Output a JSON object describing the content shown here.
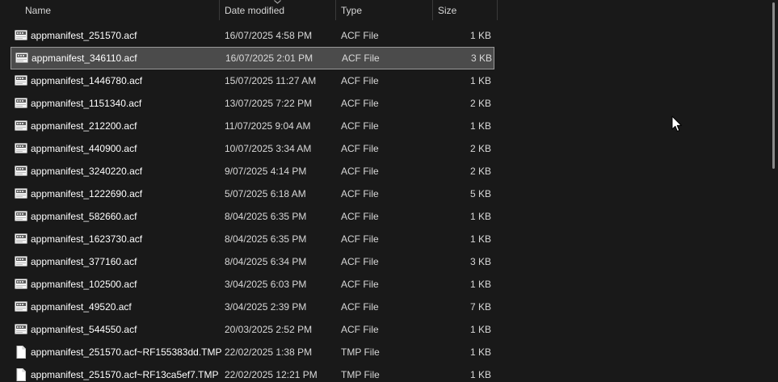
{
  "columns": {
    "name": "Name",
    "date": "Date modified",
    "type": "Type",
    "size": "Size"
  },
  "sort": {
    "column": "date",
    "icon": "sort-descending-icon"
  },
  "files": [
    {
      "name": "appmanifest_251570.acf",
      "date": "16/07/2025 4:58 PM",
      "type": "ACF File",
      "size": "1 KB",
      "icon": "acf-file-icon",
      "selected": false
    },
    {
      "name": "appmanifest_346110.acf",
      "date": "16/07/2025 2:01 PM",
      "type": "ACF File",
      "size": "3 KB",
      "icon": "acf-file-icon",
      "selected": true
    },
    {
      "name": "appmanifest_1446780.acf",
      "date": "15/07/2025 11:27 AM",
      "type": "ACF File",
      "size": "1 KB",
      "icon": "acf-file-icon",
      "selected": false
    },
    {
      "name": "appmanifest_1151340.acf",
      "date": "13/07/2025 7:22 PM",
      "type": "ACF File",
      "size": "2 KB",
      "icon": "acf-file-icon",
      "selected": false
    },
    {
      "name": "appmanifest_212200.acf",
      "date": "11/07/2025 9:04 AM",
      "type": "ACF File",
      "size": "1 KB",
      "icon": "acf-file-icon",
      "selected": false
    },
    {
      "name": "appmanifest_440900.acf",
      "date": "10/07/2025 3:34 AM",
      "type": "ACF File",
      "size": "2 KB",
      "icon": "acf-file-icon",
      "selected": false
    },
    {
      "name": "appmanifest_3240220.acf",
      "date": "9/07/2025 4:14 PM",
      "type": "ACF File",
      "size": "2 KB",
      "icon": "acf-file-icon",
      "selected": false
    },
    {
      "name": "appmanifest_1222690.acf",
      "date": "5/07/2025 6:18 AM",
      "type": "ACF File",
      "size": "5 KB",
      "icon": "acf-file-icon",
      "selected": false
    },
    {
      "name": "appmanifest_582660.acf",
      "date": "8/04/2025 6:35 PM",
      "type": "ACF File",
      "size": "1 KB",
      "icon": "acf-file-icon",
      "selected": false
    },
    {
      "name": "appmanifest_1623730.acf",
      "date": "8/04/2025 6:35 PM",
      "type": "ACF File",
      "size": "1 KB",
      "icon": "acf-file-icon",
      "selected": false
    },
    {
      "name": "appmanifest_377160.acf",
      "date": "8/04/2025 6:34 PM",
      "type": "ACF File",
      "size": "3 KB",
      "icon": "acf-file-icon",
      "selected": false
    },
    {
      "name": "appmanifest_102500.acf",
      "date": "3/04/2025 6:03 PM",
      "type": "ACF File",
      "size": "1 KB",
      "icon": "acf-file-icon",
      "selected": false
    },
    {
      "name": "appmanifest_49520.acf",
      "date": "3/04/2025 2:39 PM",
      "type": "ACF File",
      "size": "7 KB",
      "icon": "acf-file-icon",
      "selected": false
    },
    {
      "name": "appmanifest_544550.acf",
      "date": "20/03/2025 2:52 PM",
      "type": "ACF File",
      "size": "1 KB",
      "icon": "acf-file-icon",
      "selected": false
    },
    {
      "name": "appmanifest_251570.acf~RF155383dd.TMP",
      "date": "22/02/2025 1:38 PM",
      "type": "TMP File",
      "size": "1 KB",
      "icon": "blank-file-icon",
      "selected": false
    },
    {
      "name": "appmanifest_251570.acf~RF13ca5ef7.TMP",
      "date": "22/02/2025 12:21 PM",
      "type": "TMP File",
      "size": "1 KB",
      "icon": "blank-file-icon",
      "selected": false
    }
  ],
  "colors": {
    "background": "#191919",
    "selection": "#4b4b4b",
    "selection_border": "#9a9a9a",
    "text": "#ffffff"
  }
}
